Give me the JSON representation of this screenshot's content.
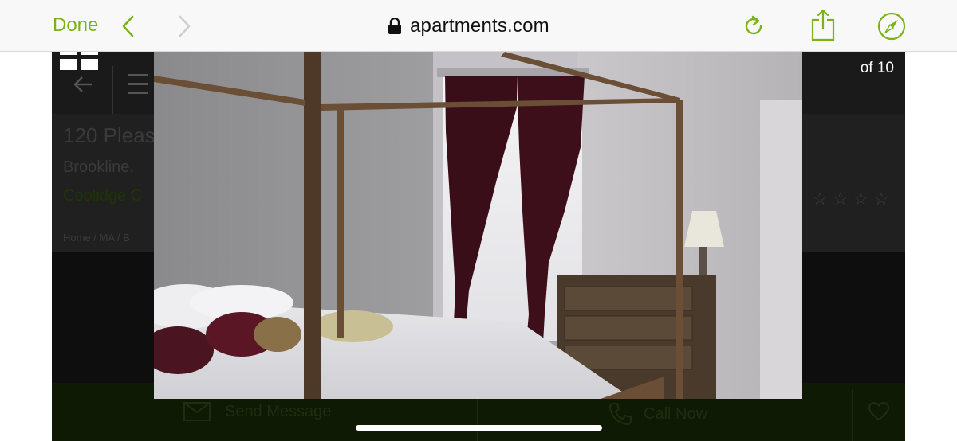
{
  "browser": {
    "done_label": "Done",
    "url": "apartments.com",
    "accent_color": "#7ab317"
  },
  "gallery": {
    "counter": "of 10"
  },
  "listing": {
    "address": "120 Pleas",
    "city": "Brookline,",
    "neighborhood": "Coolidge C",
    "breadcrumb": "Home / MA / B",
    "rating_stars": "☆☆☆☆"
  },
  "actions": {
    "send_message": "Send Message",
    "call_now": "Call Now"
  },
  "icons": {
    "back": "chevron-left-icon",
    "forward": "chevron-right-icon",
    "lock": "lock-icon",
    "reload": "reload-icon",
    "share": "share-icon",
    "compass": "compass-icon",
    "grid": "grid-icon",
    "menu": "menu-icon",
    "mail": "mail-icon",
    "phone": "phone-icon",
    "heart": "heart-icon"
  }
}
